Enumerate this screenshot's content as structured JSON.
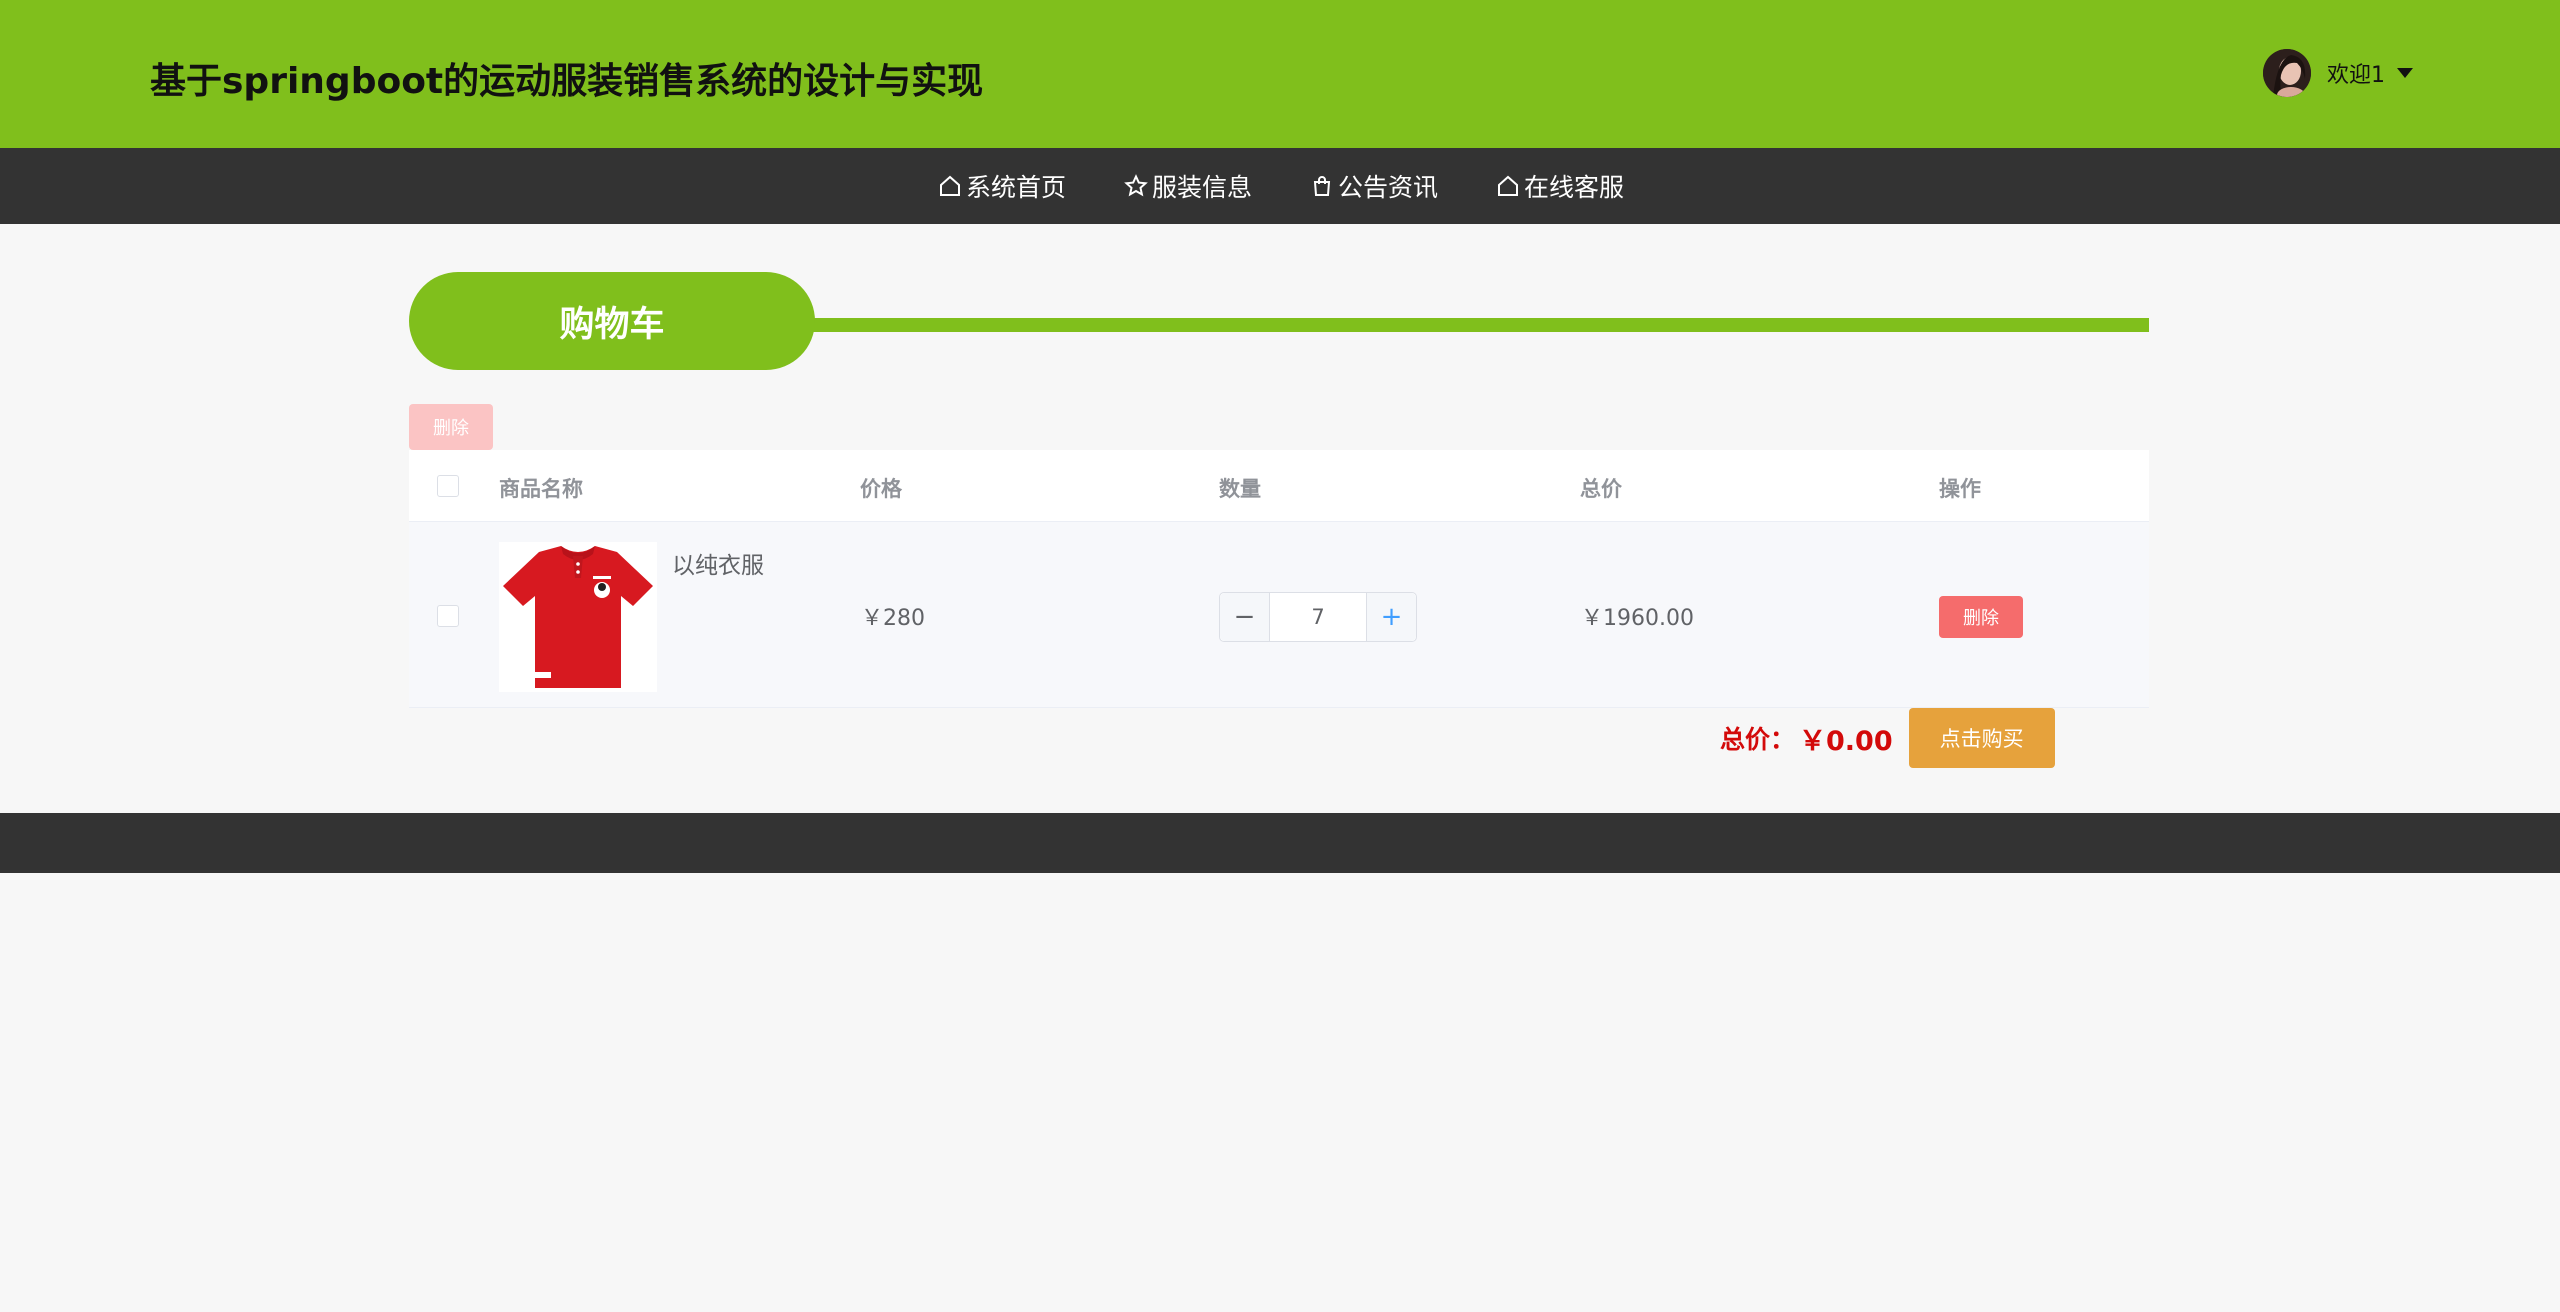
{
  "header": {
    "site_title": "基于springboot的运动服装销售系统的设计与实现",
    "welcome": "欢迎1",
    "brand_color": "#80bf1c"
  },
  "nav": {
    "items": [
      {
        "label": "系统首页",
        "icon": "home-icon"
      },
      {
        "label": "服装信息",
        "icon": "star-icon"
      },
      {
        "label": "公告资讯",
        "icon": "bag-icon"
      },
      {
        "label": "在线客服",
        "icon": "home-icon"
      }
    ]
  },
  "page": {
    "section_title": "购物车",
    "bulk_delete_label": "删除"
  },
  "table": {
    "columns": [
      "商品名称",
      "价格",
      "数量",
      "总价",
      "操作"
    ],
    "rows": [
      {
        "name": "以纯衣服",
        "price": "￥280",
        "quantity": "7",
        "total": "￥1960.00",
        "action_label": "删除",
        "image": "red-polo-shirt"
      }
    ]
  },
  "summary": {
    "label": "总价：",
    "value": "￥0.00",
    "buy_label": "点击购买"
  },
  "colors": {
    "nav_bg": "#333333",
    "delete": "#f56c6c",
    "buy": "#e6a23c",
    "total_text": "#d30a0a"
  }
}
